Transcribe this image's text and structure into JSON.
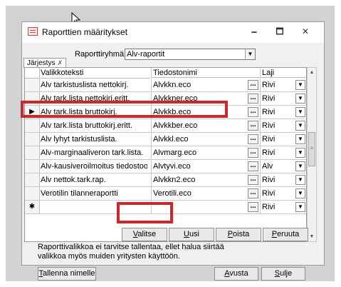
{
  "window": {
    "title": "Raporttien määritykset",
    "minimize": "🗕",
    "maximize": "🗖",
    "close": "✕"
  },
  "group": {
    "label": "Raporttiryhmä",
    "value": "Alv-raportit"
  },
  "tab": {
    "label": "Järjestys",
    "close": "✗"
  },
  "table": {
    "headers": [
      "Valikkoteksti",
      "Tiedostonimi",
      "Laji"
    ],
    "current_row_index": 2,
    "rows": [
      {
        "text": "Alv tarkistuslista nettokirj.",
        "file": "Alvkkn.eco",
        "type": "Rivi"
      },
      {
        "text": "Alv tark.lista nettokirj.eritt.",
        "file": "Alvkkner.eco",
        "type": "Rivi"
      },
      {
        "text": "Alv tark.lista bruttokirj.",
        "file": "Alvkkb.eco",
        "type": "Rivi"
      },
      {
        "text": "Alv tark.lista bruttokirj.eritt.",
        "file": "Alvkkber.eco",
        "type": "Rivi"
      },
      {
        "text": "Alv lyhyt tarkistuslista.",
        "file": "Alvkkl.eco",
        "type": "Rivi"
      },
      {
        "text": "Alv-marginaaliveron tark.lista.",
        "file": "Alvmarg.eco",
        "type": "Rivi"
      },
      {
        "text": "Alv-kausiveroilmoitus tiedostoon",
        "file": "Alvtyvi.eco",
        "type": "Alv"
      },
      {
        "text": "Alv nettok.tark.rap.",
        "file": "Alvkkn2.eco",
        "type": "Rivi"
      },
      {
        "text": "Verotilin tilanneraportti",
        "file": "Verotili.eco",
        "type": "Rivi"
      }
    ],
    "new_row": {
      "marker": "✱",
      "type": "Rivi"
    },
    "ellipsis": "...",
    "dropdown_glyph": "▼",
    "current_marker": "▶"
  },
  "buttons": {
    "select": "Valitse",
    "new": "Uusi",
    "delete": "Poista",
    "cancel": "Peruuta",
    "save_as": "Tallenna nimelle",
    "help": "Avusta",
    "close": "Sulje"
  },
  "note": "Raporttivalikkoa ei tarvitse tallentaa, ellet halua siirtää valikkoa myös muiden yritysten käyttöön.",
  "colors": {
    "highlight": "#d0262b"
  }
}
